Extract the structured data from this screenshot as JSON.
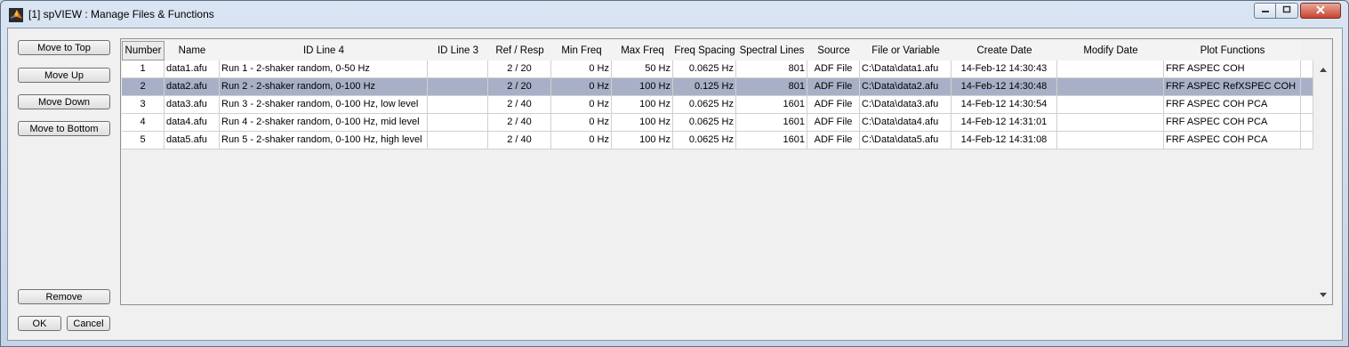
{
  "window": {
    "title": "[1] spVIEW : Manage Files & Functions",
    "app_icon": "matlab-icon",
    "controls": [
      "minimize-icon",
      "maximize-icon",
      "close-icon"
    ]
  },
  "side_buttons": {
    "move_to_top": "Move to Top",
    "move_up": "Move Up",
    "move_down": "Move Down",
    "move_to_bottom": "Move to Bottom",
    "remove": "Remove",
    "ok": "OK",
    "cancel": "Cancel"
  },
  "table": {
    "columns": [
      "Number",
      "Name",
      "ID Line 4",
      "ID Line 3",
      "Ref / Resp",
      "Min Freq",
      "Max Freq",
      "Freq Spacing",
      "Spectral Lines",
      "Source",
      "File or Variable",
      "Create Date",
      "Modify Date",
      "Plot Functions"
    ],
    "selected_row": 1,
    "rows": [
      [
        "1",
        "data1.afu",
        "Run 1 - 2-shaker random, 0-50 Hz",
        "",
        "2 / 20",
        "0 Hz",
        "50 Hz",
        "0.0625 Hz",
        "801",
        "ADF File",
        "C:\\Data\\data1.afu",
        "14-Feb-12   14:30:43",
        "",
        "FRF ASPEC COH"
      ],
      [
        "2",
        "data2.afu",
        "Run 2 - 2-shaker random, 0-100 Hz",
        "",
        "2 / 20",
        "0 Hz",
        "100 Hz",
        "0.125 Hz",
        "801",
        "ADF File",
        "C:\\Data\\data2.afu",
        "14-Feb-12   14:30:48",
        "",
        "FRF ASPEC RefXSPEC COH"
      ],
      [
        "3",
        "data3.afu",
        "Run 3 - 2-shaker random, 0-100 Hz, low level",
        "",
        "2 / 40",
        "0 Hz",
        "100 Hz",
        "0.0625 Hz",
        "1601",
        "ADF File",
        "C:\\Data\\data3.afu",
        "14-Feb-12   14:30:54",
        "",
        "FRF ASPEC COH PCA"
      ],
      [
        "4",
        "data4.afu",
        "Run 4 - 2-shaker random, 0-100 Hz, mid level",
        "",
        "2 / 40",
        "0 Hz",
        "100 Hz",
        "0.0625 Hz",
        "1601",
        "ADF File",
        "C:\\Data\\data4.afu",
        "14-Feb-12   14:31:01",
        "",
        "FRF ASPEC COH PCA"
      ],
      [
        "5",
        "data5.afu",
        "Run 5 - 2-shaker random, 0-100 Hz, high level",
        "",
        "2 / 40",
        "0 Hz",
        "100 Hz",
        "0.0625 Hz",
        "1601",
        "ADF File",
        "C:\\Data\\data5.afu",
        "14-Feb-12   14:31:08",
        "",
        "FRF ASPEC COH PCA"
      ]
    ]
  },
  "colors": {
    "selected_row": "#a8b0c8",
    "window_chrome": "#c9d6e6",
    "close_button": "#c74530"
  }
}
